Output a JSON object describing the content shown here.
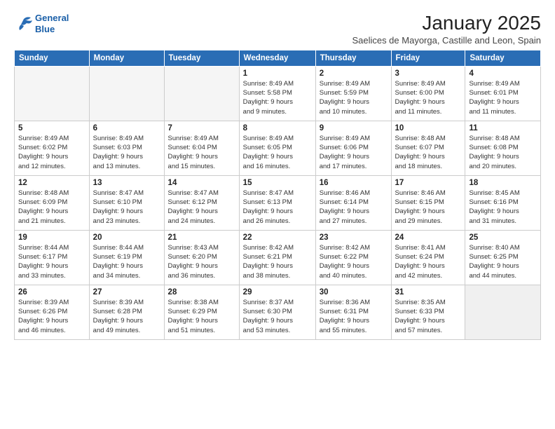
{
  "logo": {
    "line1": "General",
    "line2": "Blue"
  },
  "title": "January 2025",
  "subtitle": "Saelices de Mayorga, Castille and Leon, Spain",
  "days_header": [
    "Sunday",
    "Monday",
    "Tuesday",
    "Wednesday",
    "Thursday",
    "Friday",
    "Saturday"
  ],
  "weeks": [
    [
      {
        "num": "",
        "info": ""
      },
      {
        "num": "",
        "info": ""
      },
      {
        "num": "",
        "info": ""
      },
      {
        "num": "1",
        "info": "Sunrise: 8:49 AM\nSunset: 5:58 PM\nDaylight: 9 hours\nand 9 minutes."
      },
      {
        "num": "2",
        "info": "Sunrise: 8:49 AM\nSunset: 5:59 PM\nDaylight: 9 hours\nand 10 minutes."
      },
      {
        "num": "3",
        "info": "Sunrise: 8:49 AM\nSunset: 6:00 PM\nDaylight: 9 hours\nand 11 minutes."
      },
      {
        "num": "4",
        "info": "Sunrise: 8:49 AM\nSunset: 6:01 PM\nDaylight: 9 hours\nand 11 minutes."
      }
    ],
    [
      {
        "num": "5",
        "info": "Sunrise: 8:49 AM\nSunset: 6:02 PM\nDaylight: 9 hours\nand 12 minutes."
      },
      {
        "num": "6",
        "info": "Sunrise: 8:49 AM\nSunset: 6:03 PM\nDaylight: 9 hours\nand 13 minutes."
      },
      {
        "num": "7",
        "info": "Sunrise: 8:49 AM\nSunset: 6:04 PM\nDaylight: 9 hours\nand 15 minutes."
      },
      {
        "num": "8",
        "info": "Sunrise: 8:49 AM\nSunset: 6:05 PM\nDaylight: 9 hours\nand 16 minutes."
      },
      {
        "num": "9",
        "info": "Sunrise: 8:49 AM\nSunset: 6:06 PM\nDaylight: 9 hours\nand 17 minutes."
      },
      {
        "num": "10",
        "info": "Sunrise: 8:48 AM\nSunset: 6:07 PM\nDaylight: 9 hours\nand 18 minutes."
      },
      {
        "num": "11",
        "info": "Sunrise: 8:48 AM\nSunset: 6:08 PM\nDaylight: 9 hours\nand 20 minutes."
      }
    ],
    [
      {
        "num": "12",
        "info": "Sunrise: 8:48 AM\nSunset: 6:09 PM\nDaylight: 9 hours\nand 21 minutes."
      },
      {
        "num": "13",
        "info": "Sunrise: 8:47 AM\nSunset: 6:10 PM\nDaylight: 9 hours\nand 23 minutes."
      },
      {
        "num": "14",
        "info": "Sunrise: 8:47 AM\nSunset: 6:12 PM\nDaylight: 9 hours\nand 24 minutes."
      },
      {
        "num": "15",
        "info": "Sunrise: 8:47 AM\nSunset: 6:13 PM\nDaylight: 9 hours\nand 26 minutes."
      },
      {
        "num": "16",
        "info": "Sunrise: 8:46 AM\nSunset: 6:14 PM\nDaylight: 9 hours\nand 27 minutes."
      },
      {
        "num": "17",
        "info": "Sunrise: 8:46 AM\nSunset: 6:15 PM\nDaylight: 9 hours\nand 29 minutes."
      },
      {
        "num": "18",
        "info": "Sunrise: 8:45 AM\nSunset: 6:16 PM\nDaylight: 9 hours\nand 31 minutes."
      }
    ],
    [
      {
        "num": "19",
        "info": "Sunrise: 8:44 AM\nSunset: 6:17 PM\nDaylight: 9 hours\nand 33 minutes."
      },
      {
        "num": "20",
        "info": "Sunrise: 8:44 AM\nSunset: 6:19 PM\nDaylight: 9 hours\nand 34 minutes."
      },
      {
        "num": "21",
        "info": "Sunrise: 8:43 AM\nSunset: 6:20 PM\nDaylight: 9 hours\nand 36 minutes."
      },
      {
        "num": "22",
        "info": "Sunrise: 8:42 AM\nSunset: 6:21 PM\nDaylight: 9 hours\nand 38 minutes."
      },
      {
        "num": "23",
        "info": "Sunrise: 8:42 AM\nSunset: 6:22 PM\nDaylight: 9 hours\nand 40 minutes."
      },
      {
        "num": "24",
        "info": "Sunrise: 8:41 AM\nSunset: 6:24 PM\nDaylight: 9 hours\nand 42 minutes."
      },
      {
        "num": "25",
        "info": "Sunrise: 8:40 AM\nSunset: 6:25 PM\nDaylight: 9 hours\nand 44 minutes."
      }
    ],
    [
      {
        "num": "26",
        "info": "Sunrise: 8:39 AM\nSunset: 6:26 PM\nDaylight: 9 hours\nand 46 minutes."
      },
      {
        "num": "27",
        "info": "Sunrise: 8:39 AM\nSunset: 6:28 PM\nDaylight: 9 hours\nand 49 minutes."
      },
      {
        "num": "28",
        "info": "Sunrise: 8:38 AM\nSunset: 6:29 PM\nDaylight: 9 hours\nand 51 minutes."
      },
      {
        "num": "29",
        "info": "Sunrise: 8:37 AM\nSunset: 6:30 PM\nDaylight: 9 hours\nand 53 minutes."
      },
      {
        "num": "30",
        "info": "Sunrise: 8:36 AM\nSunset: 6:31 PM\nDaylight: 9 hours\nand 55 minutes."
      },
      {
        "num": "31",
        "info": "Sunrise: 8:35 AM\nSunset: 6:33 PM\nDaylight: 9 hours\nand 57 minutes."
      },
      {
        "num": "",
        "info": ""
      }
    ]
  ]
}
